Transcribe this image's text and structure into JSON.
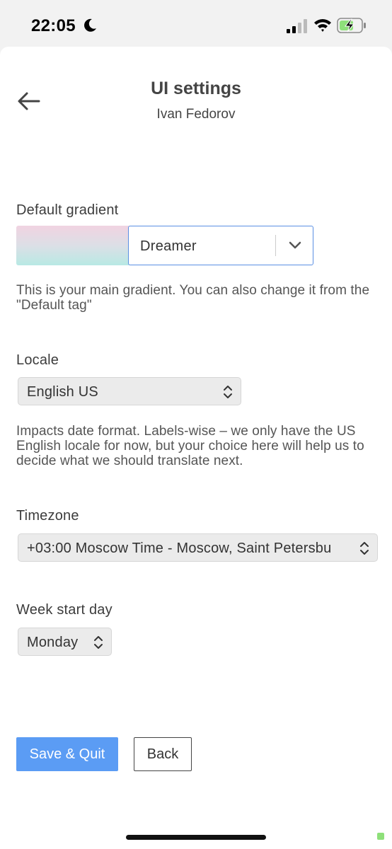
{
  "status_bar": {
    "time": "22:05",
    "icons": [
      "moon-icon",
      "cellular-signal-icon",
      "wifi-icon",
      "battery-charging-icon"
    ]
  },
  "header": {
    "title": "UI settings",
    "subtitle": "Ivan Fedorov"
  },
  "gradient": {
    "label": "Default gradient",
    "selected": "Dreamer",
    "help": "This is your main gradient. You can also change it from the \"Default tag\"",
    "swatch_colors": [
      "#f1d3e1",
      "#b8e9e4"
    ]
  },
  "locale": {
    "label": "Locale",
    "selected": "English US",
    "help": "Impacts date format. Labels-wise – we only have the US English locale for now, but your choice here will help us to decide what we should translate next."
  },
  "timezone": {
    "label": "Timezone",
    "selected": "+03:00 Moscow Time - Moscow, Saint Petersbu"
  },
  "week_start": {
    "label": "Week start day",
    "selected": "Monday"
  },
  "actions": {
    "save_label": "Save & Quit",
    "back_label": "Back"
  },
  "colors": {
    "accent": "#5b9cf4",
    "focus_border": "#5a8fe3",
    "battery_fill": "#8ee07a"
  }
}
